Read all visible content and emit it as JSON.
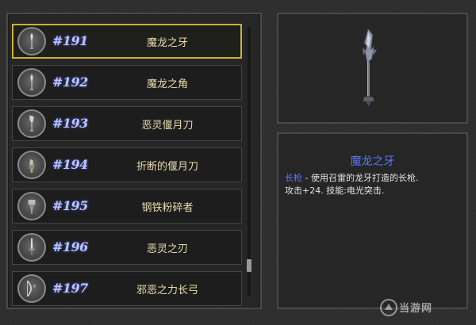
{
  "weapons": [
    {
      "number": "#191",
      "name": "魔龙之牙",
      "icon": "spear-icon",
      "selected": true
    },
    {
      "number": "#192",
      "name": "魔龙之角",
      "icon": "spear-icon",
      "selected": false
    },
    {
      "number": "#193",
      "name": "恶灵偃月刀",
      "icon": "glaive-icon",
      "selected": false
    },
    {
      "number": "#194",
      "name": "折断的偃月刀",
      "icon": "broken-glaive-icon",
      "selected": false
    },
    {
      "number": "#195",
      "name": "钢铁粉碎者",
      "icon": "hammer-icon",
      "selected": false
    },
    {
      "number": "#196",
      "name": "恶灵之刃",
      "icon": "blade-icon",
      "selected": false
    },
    {
      "number": "#197",
      "name": "邪恶之力长弓",
      "icon": "bow-icon",
      "selected": false
    }
  ],
  "detail": {
    "title": "魔龙之牙",
    "type": "长枪",
    "description": " - 使用召雷的龙牙打造的长枪.",
    "stats": "攻击+24. 技能:电光突击.",
    "preview_icon": "dragon-spear-icon"
  },
  "watermark": {
    "text": "当游网",
    "logo": "watermark-logo-icon"
  },
  "colors": {
    "selection_border": "#c8b33a",
    "number_text": "#b8c4ff",
    "name_text": "#e8dcae",
    "title_blue": "#5b78ff"
  }
}
